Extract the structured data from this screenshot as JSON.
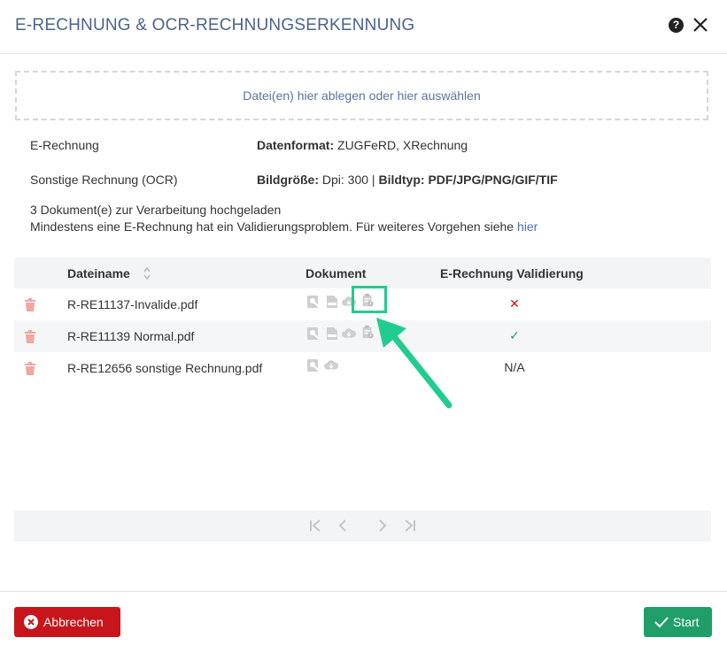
{
  "dialog": {
    "title": "E-RECHNUNG & OCR-RECHNUNGSERKENNUNG",
    "help_icon": "question-circle-icon",
    "close_icon": "close-icon"
  },
  "dropzone": {
    "text": "Datei(en) hier ablegen oder hier auswählen"
  },
  "info": {
    "erechnung_label": "E-Rechnung",
    "erechnung_key": "Datenformat:",
    "erechnung_val": "ZUGFeRD, XRechnung",
    "ocr_label": "Sonstige Rechnung (OCR)",
    "ocr_key1": "Bildgröße:",
    "ocr_val1": "Dpi: 300 |",
    "ocr_key2": "Bildtyp:",
    "ocr_val2": "PDF/JPG/PNG/GIF/TIF"
  },
  "notice": {
    "line1": "3 Dokument(e) zur Verarbeitung hochgeladen",
    "line2": "Mindestens eine E-Rechnung hat ein Validierungsproblem. Für weiteres Vorgehen siehe",
    "link": "hier"
  },
  "table": {
    "columns": {
      "name": "Dateiname",
      "doc": "Dokument",
      "valid": "E-Rechnung Validierung"
    },
    "rows": [
      {
        "name": "R-RE11137-Invalide.pdf",
        "valid": "✕",
        "valid_color": "#c8141b",
        "icons": [
          "preview-icon",
          "xml-file-icon",
          "cloud-download-icon",
          "clipboard-validation-icon"
        ]
      },
      {
        "name": "R-RE11139 Normal.pdf",
        "valid": "✓",
        "valid_color": "#1f9e69",
        "icons": [
          "preview-icon",
          "xml-file-icon",
          "cloud-download-icon",
          "clipboard-validation-icon"
        ]
      },
      {
        "name": "R-RE12656 sonstige Rechnung.pdf",
        "valid": "N/A",
        "valid_color": "#333333",
        "icons": [
          "preview-icon",
          "cloud-download-icon"
        ]
      }
    ]
  },
  "pager": {
    "icons": [
      "first-page-icon",
      "prev-page-icon",
      "next-page-icon",
      "last-page-icon"
    ]
  },
  "footer": {
    "cancel_label": "Abbrechen",
    "start_label": "Start"
  },
  "colors": {
    "accent": "#4a6489",
    "danger": "#c8141b",
    "success": "#1f9e69",
    "highlight": "#21cc8f"
  }
}
